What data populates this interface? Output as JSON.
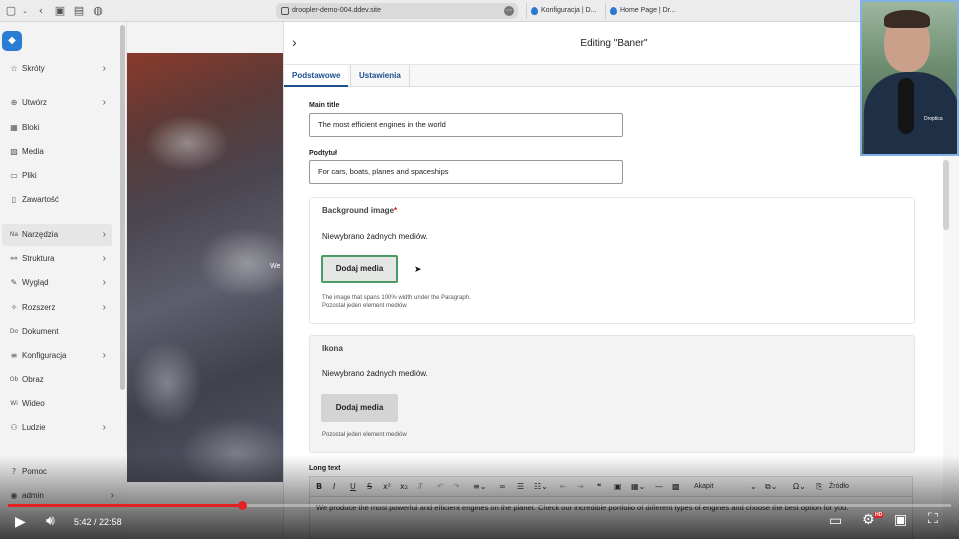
{
  "browser": {
    "url": "droopler-demo-004.ddev.site",
    "tabs": [
      {
        "label": "Konfiguracja | D..."
      },
      {
        "label": "Home Page | Dr..."
      }
    ]
  },
  "sidebar": {
    "items": [
      {
        "label": "Skróty",
        "icon": "star-icon"
      },
      {
        "label": "Utwórz",
        "icon": "plus-circle-icon"
      },
      {
        "label": "Bloki",
        "icon": "blocks-icon"
      },
      {
        "label": "Media",
        "icon": "image-icon"
      },
      {
        "label": "Pliki",
        "icon": "file-icon"
      },
      {
        "label": "Zawartość",
        "icon": "document-icon"
      },
      {
        "label": "Narzędzia",
        "icon": "tools-icon"
      },
      {
        "label": "Struktura",
        "icon": "structure-icon"
      },
      {
        "label": "Wygląd",
        "icon": "brush-icon"
      },
      {
        "label": "Rozszerz",
        "icon": "puzzle-icon"
      },
      {
        "label": "Dokument",
        "icon": "document-icon"
      },
      {
        "label": "Konfiguracja",
        "icon": "sliders-icon"
      },
      {
        "label": "Obraz",
        "icon": "picture-icon"
      },
      {
        "label": "Wideo",
        "icon": "video-icon"
      },
      {
        "label": "Ludzie",
        "icon": "people-icon"
      }
    ],
    "help_label": "Pomoc",
    "user_label": "admin"
  },
  "hero": {
    "text": "We"
  },
  "editor": {
    "title": "Editing \"Baner\"",
    "tabs": [
      {
        "label": "Podstawowe"
      },
      {
        "label": "Ustawienia"
      }
    ],
    "main_title_label": "Main title",
    "main_title_value": "The most efficient engines in the world",
    "subtitle_label": "Podtytuł",
    "subtitle_value": "For cars, boats, planes and spaceships",
    "background": {
      "legend": "Background image",
      "required_mark": "*",
      "none_text": "Niewybrano żadnych mediów.",
      "button": "Dodaj media",
      "desc1": "The image that spans 100% width under the Paragraph.",
      "desc2": "Pozostał jeden element mediów"
    },
    "icon_field": {
      "legend": "Ikona",
      "none_text": "Niewybrano żadnych mediów.",
      "button": "Dodaj media",
      "desc": "Pozostał jeden element mediów"
    },
    "long_text_label": "Long text",
    "toolbar": {
      "paragraph_select": "Akapit",
      "source_label": "Źródło"
    },
    "body_text": "We produce the most powerful and efficient engines on the planet. Check our incredible portfolio of different types of engines and choose the best option for you."
  },
  "webcam": {
    "brand": "Droptica"
  },
  "video": {
    "current_time": "5:42",
    "duration": "22:58",
    "progress": 0.248,
    "hd_badge": "HD"
  },
  "colors": {
    "accent": "#1d4f91",
    "progress": "#e52222",
    "drupal_blue": "#2b7cd3",
    "focus_green": "#4c9a68"
  }
}
